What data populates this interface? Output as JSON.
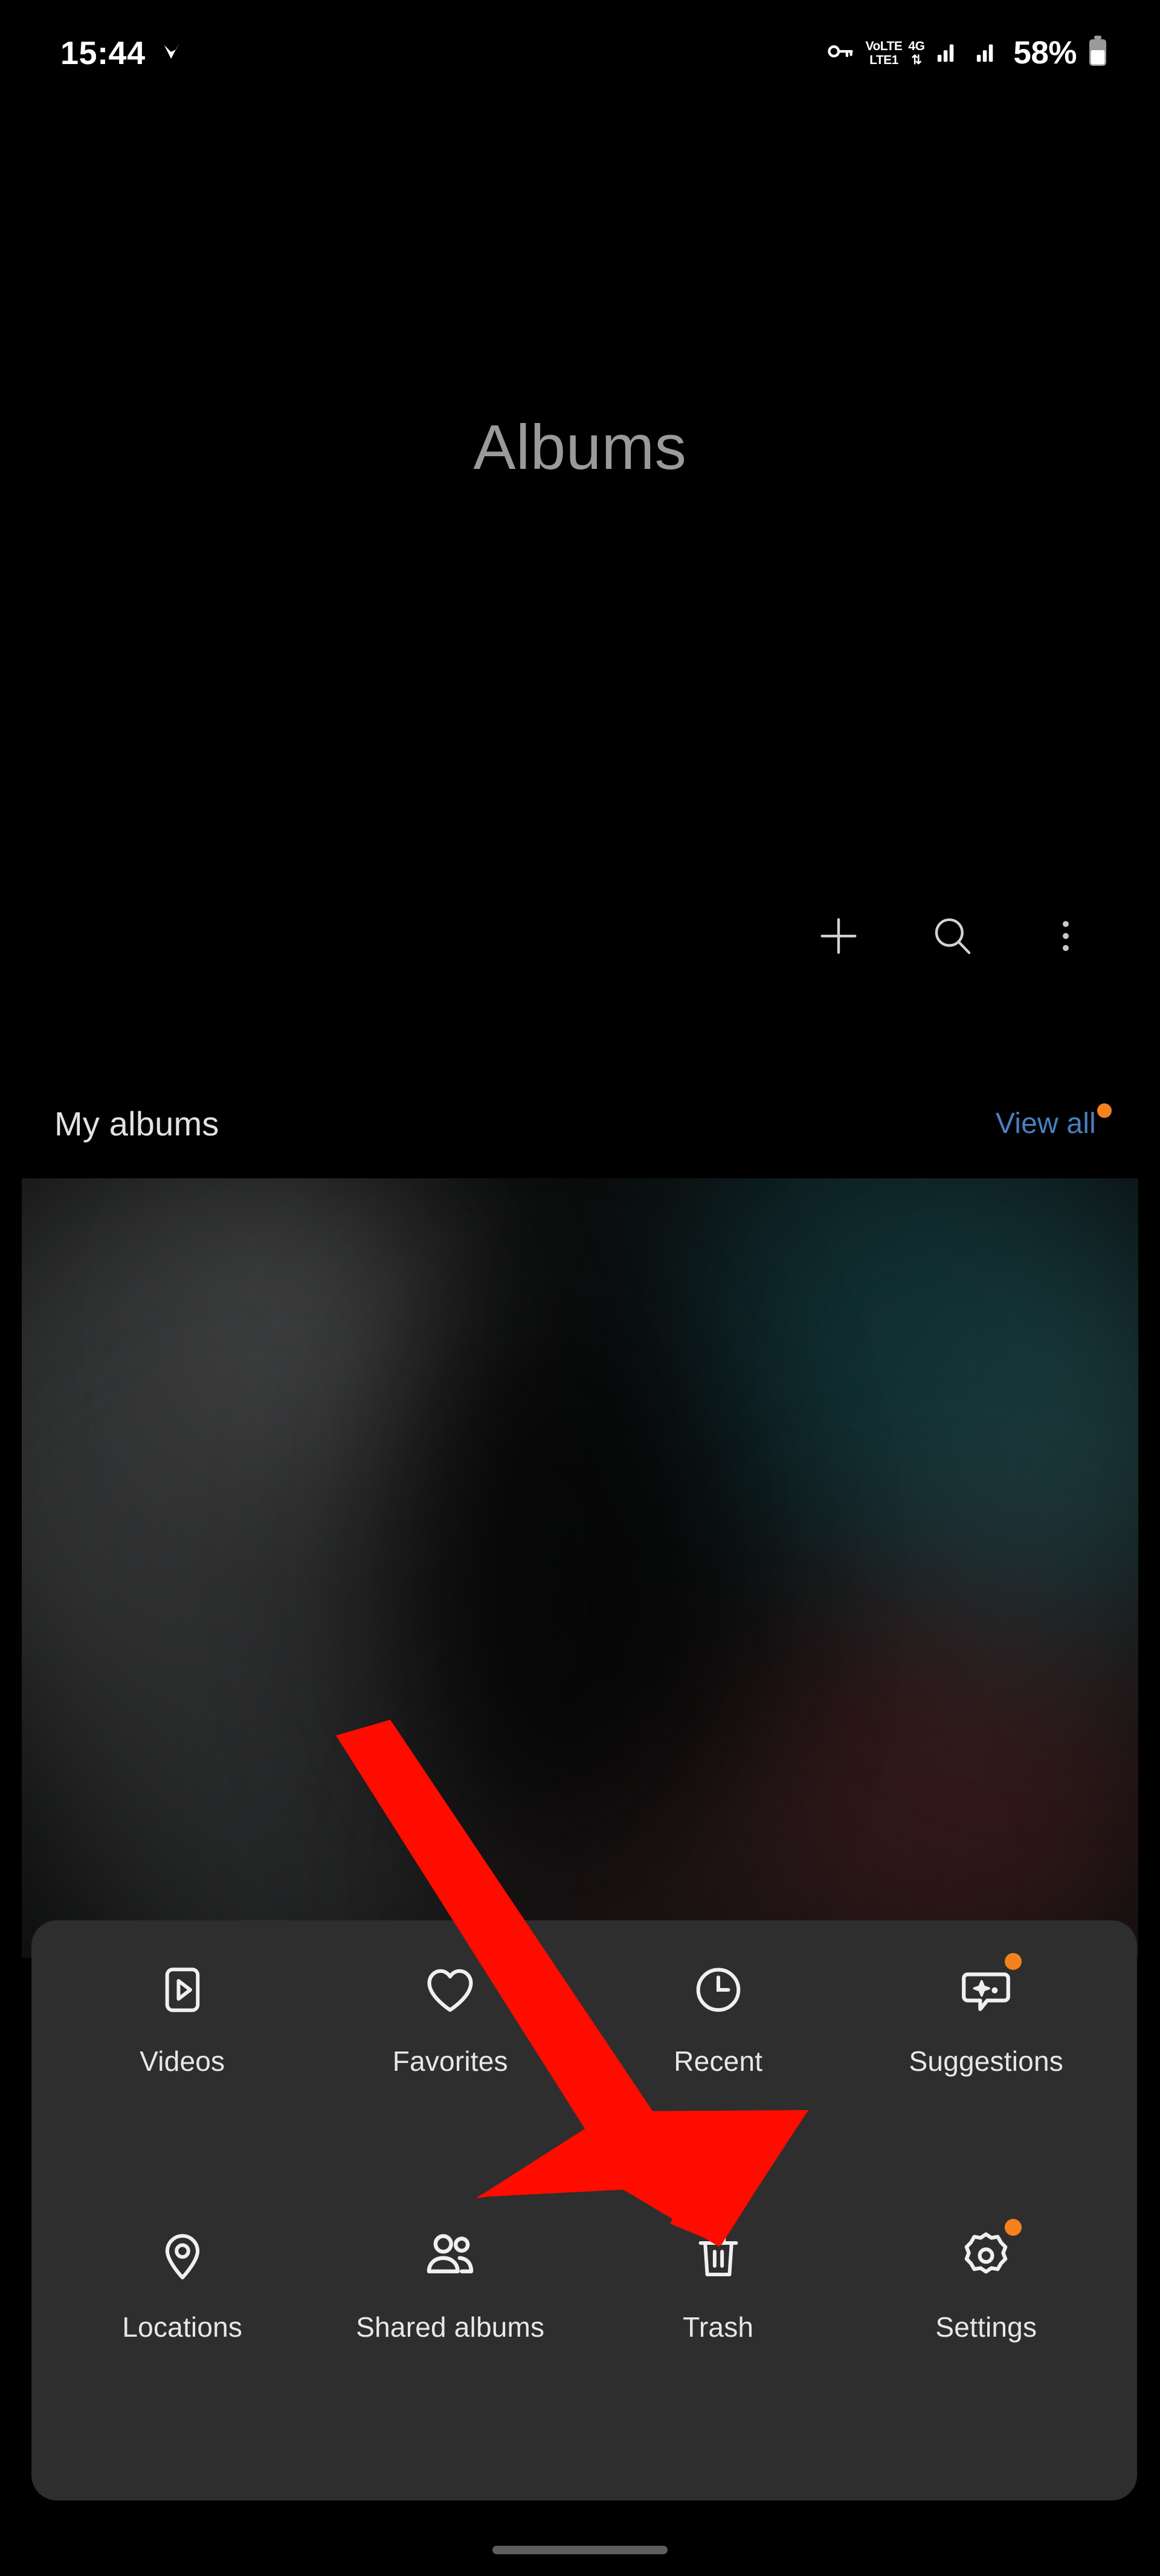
{
  "status_bar": {
    "time": "15:44",
    "notification_icon": "checkmark-icon",
    "vpn_key_icon": "vpn-key-icon",
    "volte_top": "VoLTE",
    "volte_bottom": "LTE1",
    "network_top": "4G",
    "network_bottom": "⇅",
    "signal_icon_1": "signal-bars-icon",
    "signal_icon_2": "signal-bars-icon",
    "battery_percent": "58%",
    "battery_icon": "battery-icon"
  },
  "header": {
    "title": "Albums"
  },
  "toolbar": {
    "items": [
      {
        "name": "add-album-button",
        "icon": "plus-icon"
      },
      {
        "name": "search-button",
        "icon": "search-icon"
      },
      {
        "name": "more-options-button",
        "icon": "three-dot-menu-icon"
      }
    ]
  },
  "section": {
    "title": "My albums",
    "view_all_label": "View all",
    "view_all_badge": true
  },
  "album_preview": {
    "description": "blurred-album-thumbnail"
  },
  "bottom_sheet": {
    "items": [
      {
        "label": "Videos",
        "icon": "video-play-icon",
        "badge": false,
        "name": "menu-item-videos"
      },
      {
        "label": "Favorites",
        "icon": "heart-icon",
        "badge": false,
        "name": "menu-item-favorites"
      },
      {
        "label": "Recent",
        "icon": "clock-icon",
        "badge": false,
        "name": "menu-item-recent"
      },
      {
        "label": "Suggestions",
        "icon": "suggestion-bubble-icon",
        "badge": true,
        "name": "menu-item-suggestions"
      },
      {
        "label": "Locations",
        "icon": "map-pin-icon",
        "badge": false,
        "name": "menu-item-locations"
      },
      {
        "label": "Shared albums",
        "icon": "people-icon",
        "badge": false,
        "name": "menu-item-shared-albums"
      },
      {
        "label": "Trash",
        "icon": "trash-icon",
        "badge": false,
        "name": "menu-item-trash"
      },
      {
        "label": "Settings",
        "icon": "gear-icon",
        "badge": true,
        "name": "menu-item-settings"
      }
    ]
  },
  "annotation": {
    "arrow_color": "#FF0C00",
    "arrow_target": "menu-item-trash"
  },
  "navigation": {
    "gesture_pill": "home-gesture-pill"
  },
  "colors": {
    "background": "#000000",
    "sheet": "#2E2E2E",
    "accent_blue": "#4A7FC1",
    "badge_orange": "#F5821F",
    "arrow_red": "#FF0C00",
    "title_gray": "#9A9A9A"
  }
}
